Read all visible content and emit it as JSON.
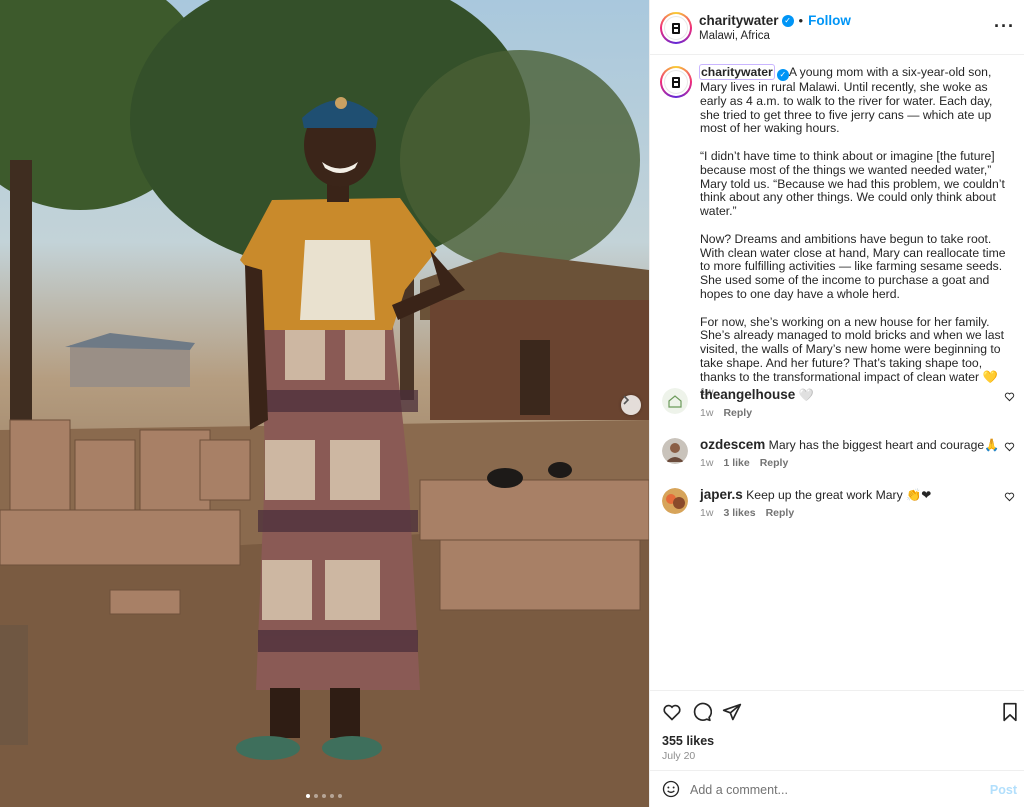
{
  "post": {
    "author": "charitywater",
    "verified_mark": "✓",
    "follow_label": "Follow",
    "separator": "•",
    "location": "Malawi, Africa",
    "more_icon": "more-horizontal-icon",
    "caption": "A young mom with a six-year-old son, Mary lives in rural Malawi. Until recently, she woke as early as 4 a.m. to walk to the river for water. Each day, she tried to get three to five jerry cans — which ate up most of her waking hours.\n\n“I didn’t have time to think about or imagine [the future] because most of the things we wanted needed water,” Mary told us. “Because we had this problem, we couldn’t think about any other things. We could only think about water.”\n\nNow? Dreams and ambitions have begun to take root. With clean water close at hand, Mary can reallocate time to more fulfilling activities — like farming sesame seeds. She used some of the income to purchase a goat and hopes to one day have a whole herd.\n\nFor now, she’s working on a new house for her family. She’s already managed to mold bricks and when we last visited, the walls of Mary’s new home were beginning to take shape. And her future? That’s taking shape too, thanks to the transformational impact of clean water 💛",
    "caption_time": "1w",
    "likes": "355 likes",
    "date": "July 20"
  },
  "carousel": {
    "dots_total": 5,
    "active_dot": 0
  },
  "comments": [
    {
      "user": "theangelhouse",
      "text": "🤍",
      "time": "1w",
      "likes": "",
      "reply": "Reply"
    },
    {
      "user": "ozdescem",
      "text": "Mary has the biggest heart and courage🙏",
      "time": "1w",
      "likes": "1 like",
      "reply": "Reply"
    },
    {
      "user": "japer.s",
      "text": "Keep up the great work Mary 👏❤",
      "time": "1w",
      "likes": "3 likes",
      "reply": "Reply"
    }
  ],
  "composer": {
    "placeholder": "Add a comment...",
    "post_label": "Post"
  },
  "colors": {
    "accent": "#0095f6",
    "muted": "#8e8e8e",
    "post_disabled": "#b2dffc"
  }
}
